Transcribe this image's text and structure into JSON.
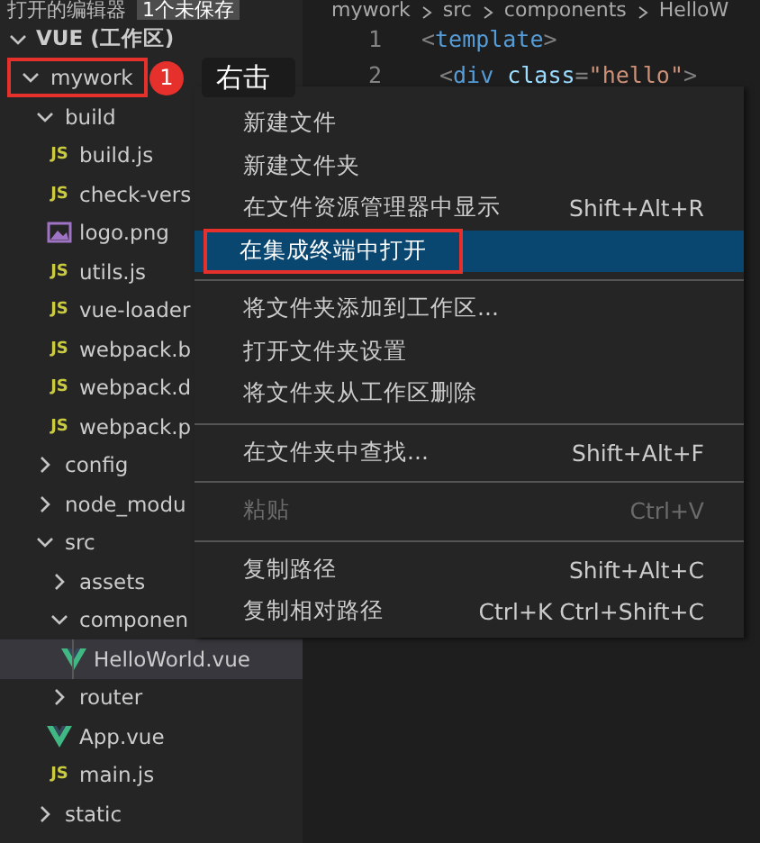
{
  "header": {
    "title": "打开的编辑器",
    "badge": "1个未保存"
  },
  "breadcrumb": [
    "mywork",
    "src",
    "components",
    "HelloW"
  ],
  "explorer": {
    "title": "VUE (工作区)",
    "expanded": true,
    "tree": [
      {
        "label": "mywork",
        "kind": "folder",
        "expanded": true,
        "outlined": true,
        "selected": false,
        "children": [
          {
            "label": "build",
            "kind": "folder",
            "expanded": true,
            "selected": false,
            "children": [
              {
                "label": "build.js",
                "kind": "js",
                "icon_text": "JS",
                "selected": false
              },
              {
                "label": "check-vers",
                "kind": "js",
                "icon_text": "JS",
                "selected": false
              },
              {
                "label": "logo.png",
                "kind": "image",
                "selected": false
              },
              {
                "label": "utils.js",
                "kind": "js",
                "icon_text": "JS",
                "selected": false
              },
              {
                "label": "vue-loader",
                "kind": "js",
                "icon_text": "JS",
                "selected": false
              },
              {
                "label": "webpack.b",
                "kind": "js",
                "icon_text": "JS",
                "selected": false
              },
              {
                "label": "webpack.d",
                "kind": "js",
                "icon_text": "JS",
                "selected": false
              },
              {
                "label": "webpack.p",
                "kind": "js",
                "icon_text": "JS",
                "selected": false
              }
            ]
          },
          {
            "label": "config",
            "kind": "folder",
            "expanded": false,
            "selected": false
          },
          {
            "label": "node_modu",
            "kind": "folder",
            "expanded": false,
            "selected": false
          },
          {
            "label": "src",
            "kind": "folder",
            "expanded": true,
            "selected": false,
            "children": [
              {
                "label": "assets",
                "kind": "folder",
                "expanded": false,
                "selected": false
              },
              {
                "label": "componen",
                "kind": "folder",
                "expanded": true,
                "selected": false,
                "children": [
                  {
                    "label": "HelloWorld.vue",
                    "kind": "vue",
                    "selected": true
                  }
                ]
              },
              {
                "label": "router",
                "kind": "folder",
                "expanded": false,
                "selected": false
              },
              {
                "label": "App.vue",
                "kind": "vue",
                "selected": false
              },
              {
                "label": "main.js",
                "kind": "js",
                "icon_text": "JS",
                "selected": false
              }
            ]
          },
          {
            "label": "static",
            "kind": "folder",
            "expanded": false,
            "selected": false
          }
        ]
      }
    ]
  },
  "editor": {
    "lines": [
      {
        "number": "1",
        "tokens": [
          {
            "kind": "punct",
            "text": "<"
          },
          {
            "kind": "tag",
            "text": "template"
          },
          {
            "kind": "punct",
            "text": ">"
          }
        ]
      },
      {
        "number": "2",
        "tokens": [
          {
            "kind": "punct",
            "text": "<"
          },
          {
            "kind": "tag",
            "text": "div"
          },
          {
            "kind": "attr",
            "text": " class"
          },
          {
            "kind": "punct",
            "text": "="
          },
          {
            "kind": "string",
            "text": "\"hello\""
          },
          {
            "kind": "punct",
            "text": ">"
          }
        ]
      }
    ]
  },
  "annotation": {
    "step": "1",
    "hint": "右击"
  },
  "context_menu": {
    "groups": [
      [
        {
          "label": "新建文件",
          "disabled": false,
          "selected": false
        },
        {
          "label": "新建文件夹",
          "disabled": false,
          "selected": false
        },
        {
          "label": "在文件资源管理器中显示",
          "shortcut": "Shift+Alt+R",
          "disabled": false,
          "selected": false
        },
        {
          "label": "在集成终端中打开",
          "disabled": false,
          "selected": true,
          "outlined": true
        }
      ],
      [
        {
          "label": "将文件夹添加到工作区...",
          "disabled": false,
          "selected": false
        },
        {
          "label": "打开文件夹设置",
          "disabled": false,
          "selected": false
        },
        {
          "label": "将文件夹从工作区删除",
          "disabled": false,
          "selected": false
        }
      ],
      [
        {
          "label": "在文件夹中查找...",
          "shortcut": "Shift+Alt+F",
          "disabled": false,
          "selected": false
        }
      ],
      [
        {
          "label": "粘贴",
          "shortcut": "Ctrl+V",
          "disabled": true,
          "selected": false
        }
      ],
      [
        {
          "label": "复制路径",
          "shortcut": "Shift+Alt+C",
          "disabled": false,
          "selected": false
        },
        {
          "label": "复制相对路径",
          "shortcut": "Ctrl+K Ctrl+Shift+C",
          "disabled": false,
          "selected": false
        }
      ]
    ]
  }
}
